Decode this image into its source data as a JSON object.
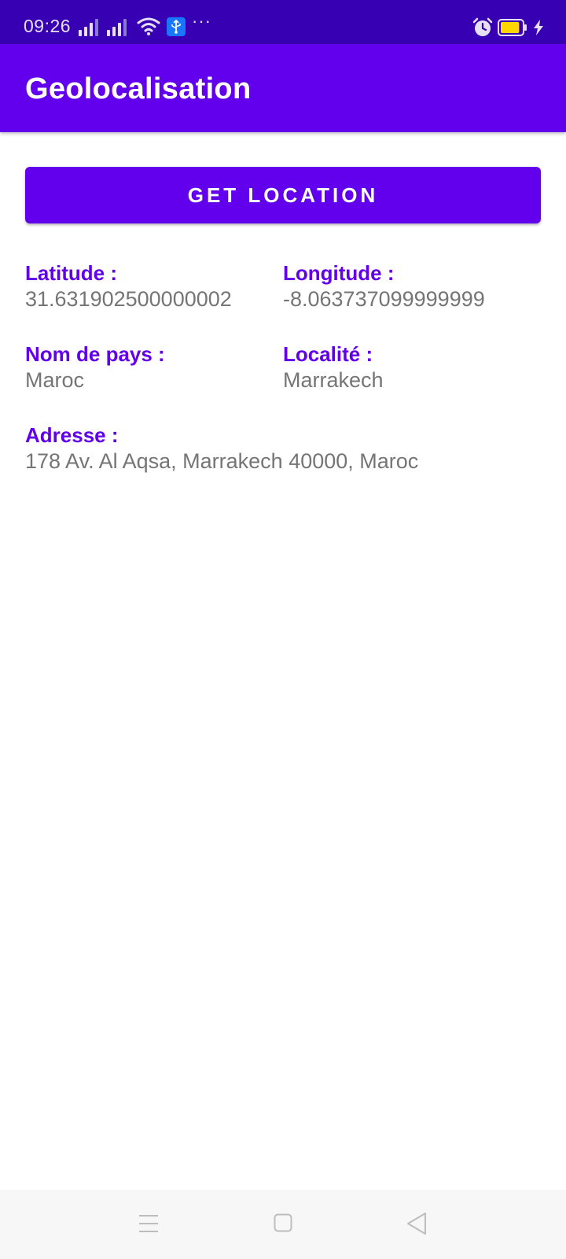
{
  "status_bar": {
    "time": "09:26",
    "more_indicator": "···",
    "icons": [
      "signal-icon",
      "signal-icon",
      "wifi-icon",
      "usb-icon",
      "alarm-icon",
      "battery-icon",
      "charging-icon"
    ],
    "battery_level": 0.9,
    "battery_color": "#FFD600"
  },
  "app_bar": {
    "title": "Geolocalisation"
  },
  "button": {
    "label": "GET LOCATION"
  },
  "fields": {
    "latitude": {
      "label": "Latitude :",
      "value": "31.631902500000002"
    },
    "longitude": {
      "label": "Longitude :",
      "value": "-8.063737099999999"
    },
    "country": {
      "label": "Nom de pays :",
      "value": "Maroc"
    },
    "locality": {
      "label": "Localité :",
      "value": "Marrakech"
    },
    "address": {
      "label": "Adresse :",
      "value": "178 Av. Al Aqsa, Marrakech 40000, Maroc"
    }
  },
  "nav_bar": {
    "icons": [
      "menu-icon",
      "home-icon",
      "back-icon"
    ]
  },
  "colors": {
    "primary": "#6200EE",
    "primary_dark": "#3700B3",
    "value_text": "#757575"
  }
}
